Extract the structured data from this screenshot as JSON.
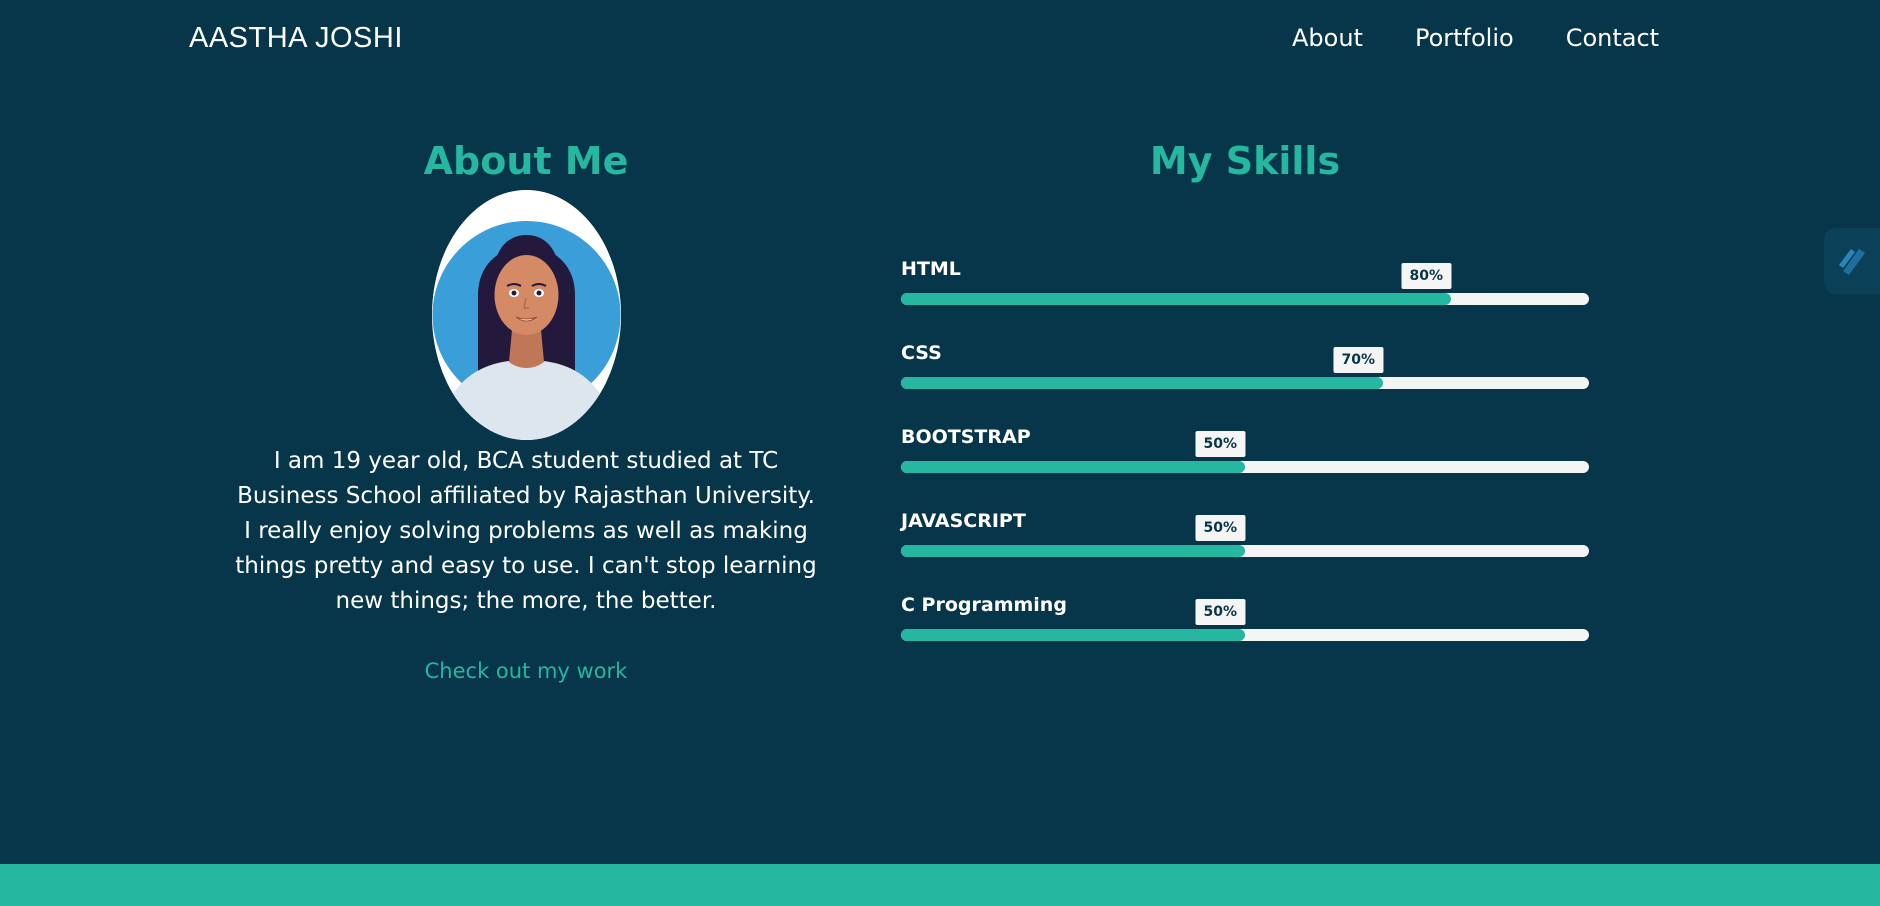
{
  "nav": {
    "brand": "AASTHA JOSHI",
    "links": [
      {
        "label": "About"
      },
      {
        "label": "Portfolio"
      },
      {
        "label": "Contact"
      }
    ]
  },
  "about": {
    "title": "About Me",
    "text": "I am 19 year old, BCA student studied at TC Business School affiliated by Rajasthan University. I really enjoy solving problems as well as making things pretty and easy to use. I can't stop learning new things; the more, the better.",
    "cta": "Check out my work"
  },
  "skills": {
    "title": "My Skills",
    "items": [
      {
        "name": "HTML",
        "level": 80,
        "badge": "80%"
      },
      {
        "name": "CSS",
        "level": 70,
        "badge": "70%"
      },
      {
        "name": "BOOTSTRAP",
        "level": 50,
        "badge": "50%"
      },
      {
        "name": "JAVASCRIPT",
        "level": 50,
        "badge": "50%"
      },
      {
        "name": "C Programming",
        "level": 50,
        "badge": "50%"
      }
    ]
  },
  "colors": {
    "background": "#07364a",
    "accent": "#25b79f",
    "track": "#f5f5f5"
  },
  "icons": {
    "side_widget": "slash-logo-icon",
    "avatar": "avatar-illustration"
  }
}
